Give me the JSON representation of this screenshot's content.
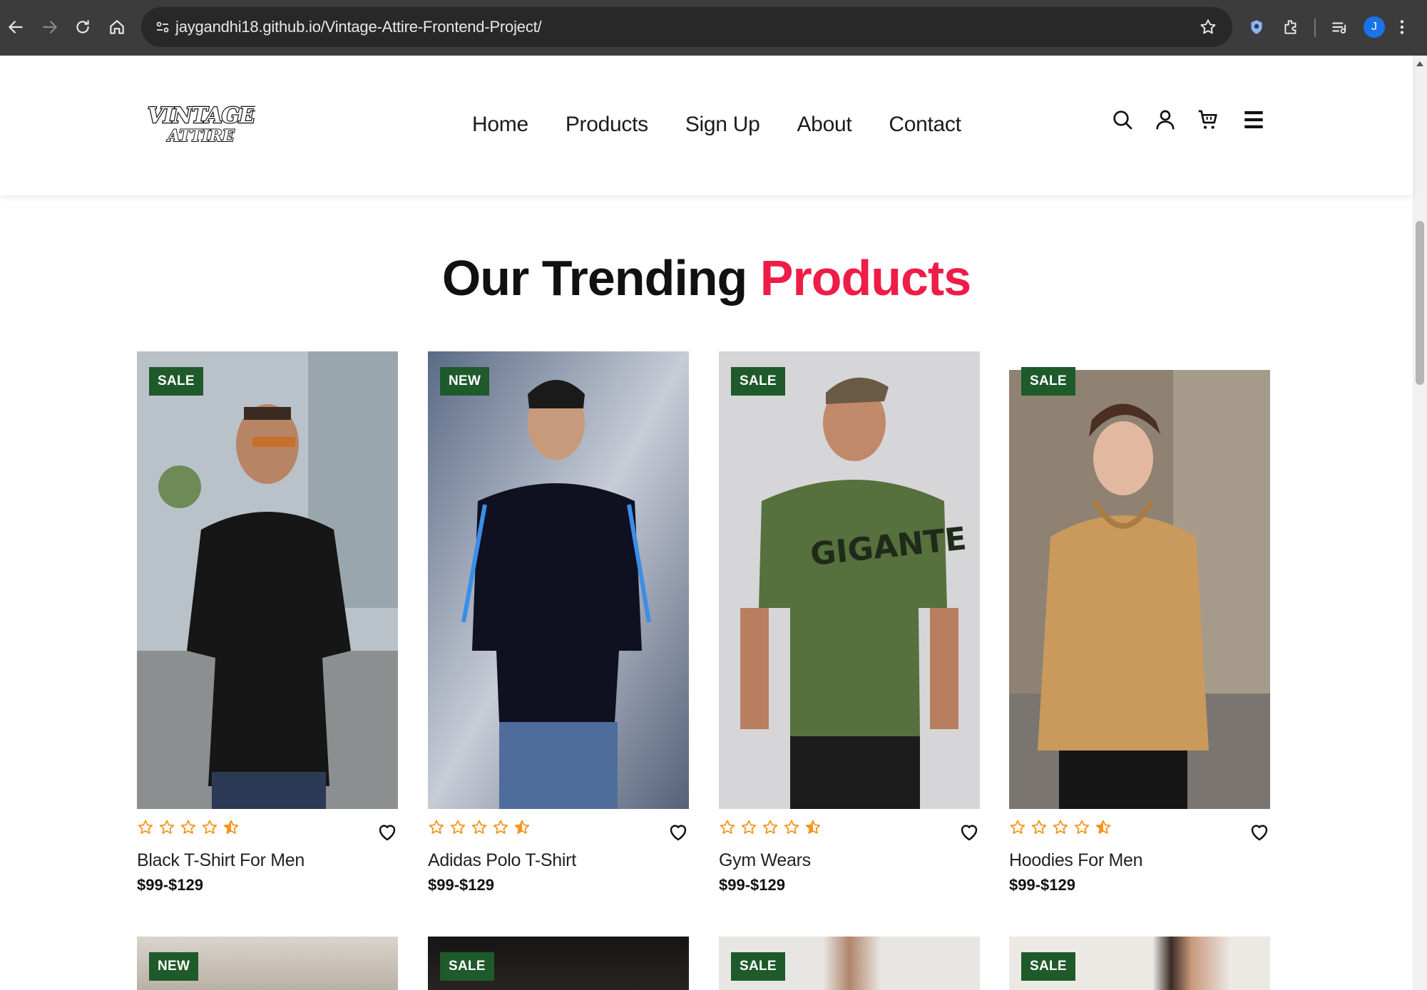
{
  "browser": {
    "url": "jaygandhi18.github.io/Vintage-Attire-Frontend-Project/",
    "profile_initial": "J",
    "icons": [
      "back-icon",
      "forward-icon",
      "reload-icon",
      "home-icon",
      "site-info-icon",
      "bookmark-star-icon",
      "extension-shield-icon",
      "extensions-puzzle-icon",
      "media-queue-icon",
      "profile-avatar"
    ]
  },
  "header": {
    "logo_line1": "VINTAGE",
    "logo_line2": "ATTIRE",
    "nav": [
      "Home",
      "Products",
      "Sign Up",
      "About",
      "Contact"
    ],
    "icons": [
      "search-icon",
      "user-icon",
      "cart-icon",
      "menu-icon"
    ]
  },
  "section": {
    "title_part1": "Our Trending ",
    "title_part2": "Products",
    "accent_color": "#ee1c47"
  },
  "products": [
    {
      "badge": "SALE",
      "name": "Black T-Shirt For Men",
      "price": "$99-$129",
      "rating": 4.5
    },
    {
      "badge": "NEW",
      "name": "Adidas Polo T-Shirt",
      "price": "$99-$129",
      "rating": 4.5
    },
    {
      "badge": "SALE",
      "name": "Gym Wears",
      "price": "$99-$129",
      "rating": 4.5
    },
    {
      "badge": "SALE",
      "name": "Hoodies For Men",
      "price": "$99-$129",
      "rating": 4.5
    }
  ],
  "products_row2": [
    {
      "badge": "NEW"
    },
    {
      "badge": "SALE"
    },
    {
      "badge": "SALE"
    },
    {
      "badge": "SALE"
    }
  ],
  "colors": {
    "badge_bg": "#1f5a2b",
    "star": "#f7941d",
    "chrome_bg": "#3c3c3c"
  }
}
